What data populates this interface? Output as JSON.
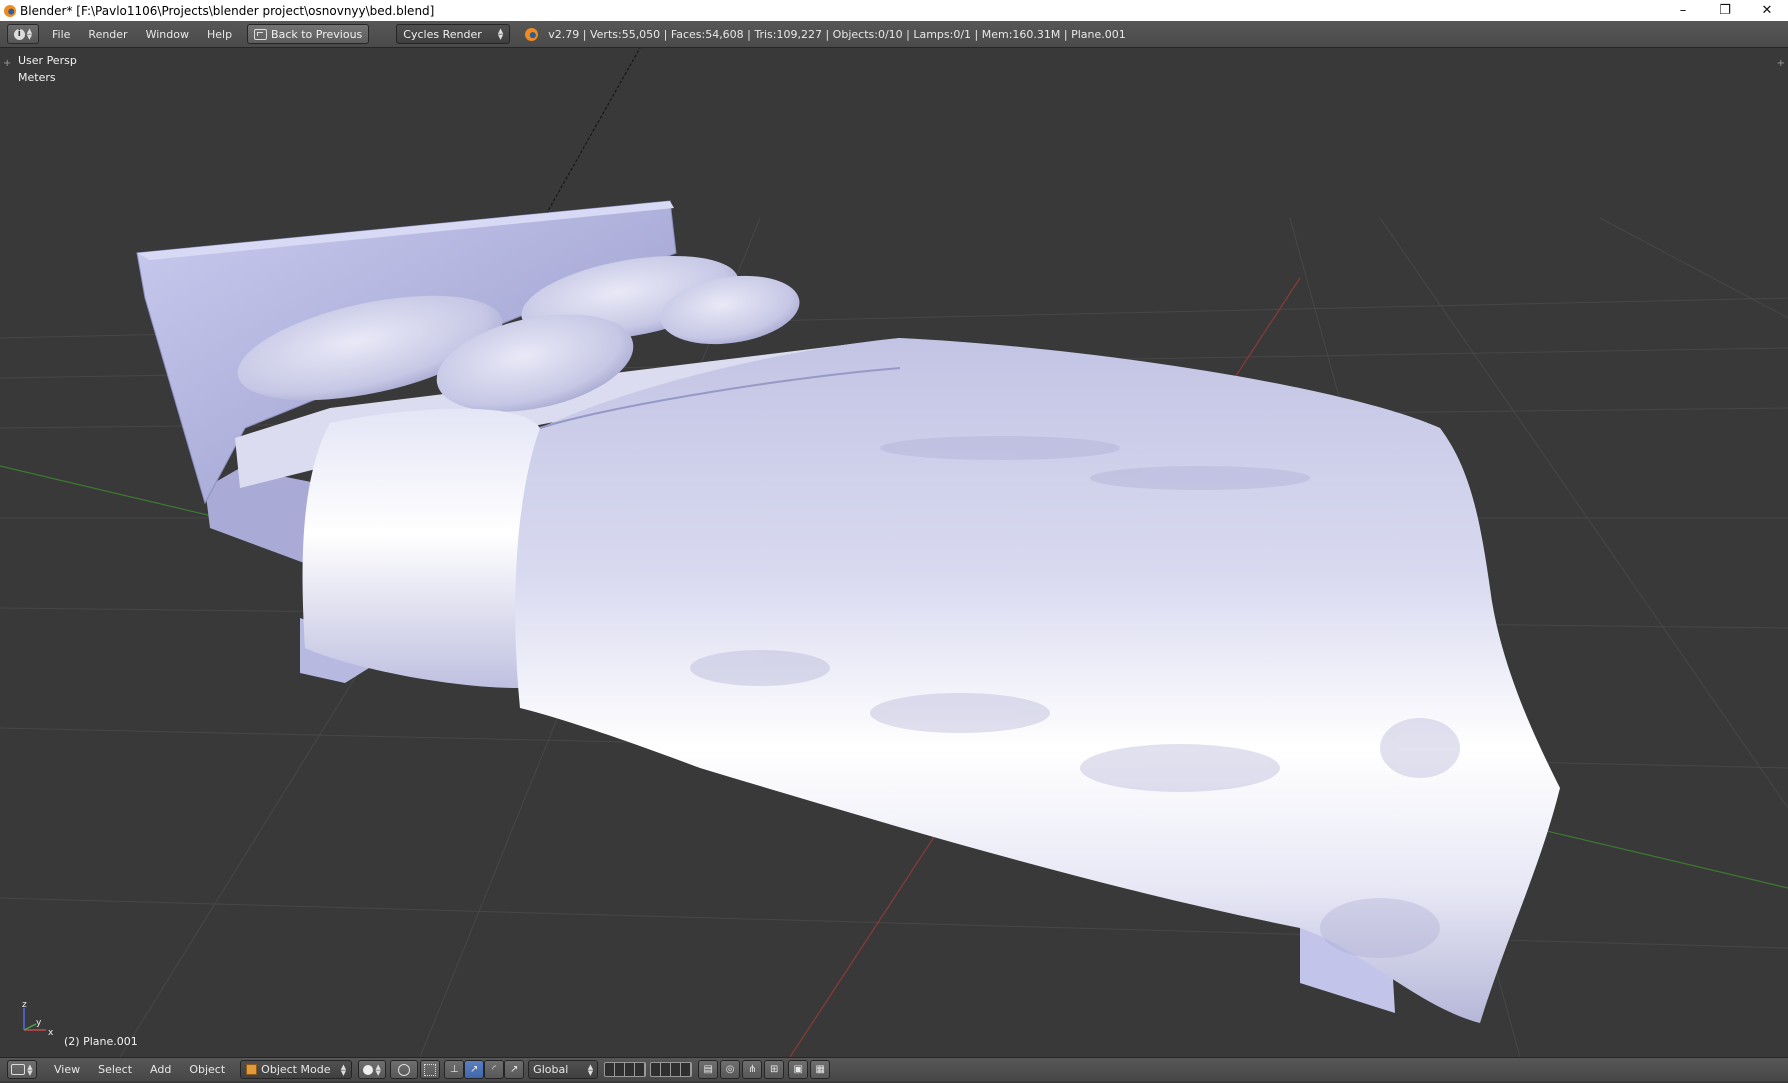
{
  "titlebar": {
    "title": "Blender* [F:\\Pavlo1106\\Projects\\blender project\\osnovnyy\\bed.blend]",
    "minimize": "–",
    "restore": "❐",
    "close": "✕"
  },
  "header": {
    "menus": [
      "File",
      "Render",
      "Window",
      "Help"
    ],
    "back_button": "Back to Previous",
    "render_engine": "Cycles Render",
    "stats": "v2.79 | Verts:55,050 | Faces:54,608 | Tris:109,227 | Objects:0/10 | Lamps:0/1 | Mem:160.31M | Plane.001"
  },
  "viewport": {
    "view_name": "User Persp",
    "units": "Meters",
    "active_object": "(2) Plane.001",
    "axis_x": "x",
    "axis_y": "y",
    "axis_z": "z"
  },
  "footer": {
    "menus": [
      "View",
      "Select",
      "Add",
      "Object"
    ],
    "mode": "Object Mode",
    "orientation": "Global"
  },
  "colors": {
    "viewport_bg": "#393939",
    "grid_line": "#474747",
    "x_axis": "#8b3a3a",
    "y_axis": "#3d7a2f",
    "model": "#b9bbe0"
  }
}
